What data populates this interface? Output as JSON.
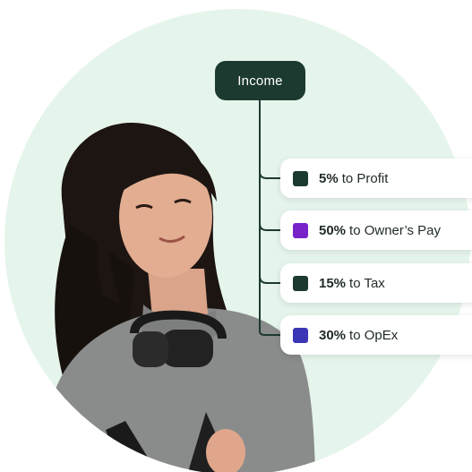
{
  "income": {
    "label": "Income"
  },
  "allocations": [
    {
      "percent": "5%",
      "label": "to Profit",
      "color": "#1c3a30"
    },
    {
      "percent": "50%",
      "label": "to Owner’s Pay",
      "color": "#7a22c9"
    },
    {
      "percent": "15%",
      "label": "to Tax",
      "color": "#1c3a30"
    },
    {
      "percent": "30%",
      "label": "to OpEx",
      "color": "#3b36b5"
    }
  ],
  "colors": {
    "circle_bg": "#e6f5ec",
    "dark_green": "#1c3a30"
  }
}
